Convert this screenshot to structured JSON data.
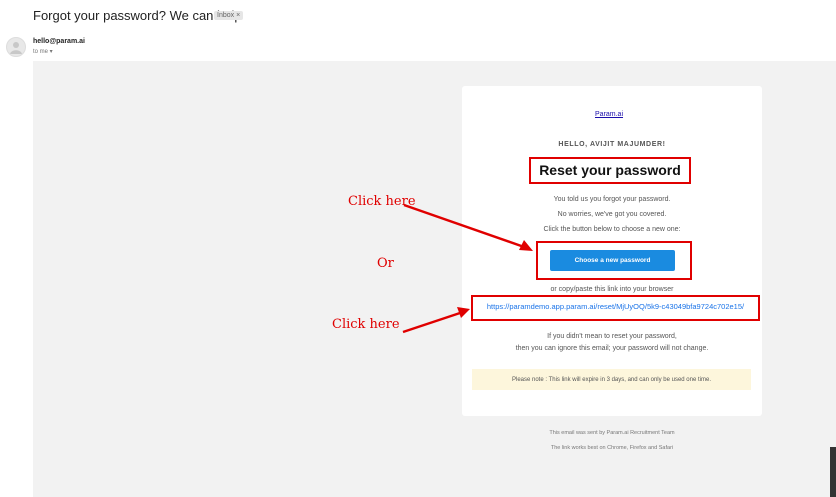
{
  "email": {
    "subject": "Forgot your password? We can help",
    "inbox_chip": "Inbox ×",
    "sender": "hello@param.ai",
    "to_line": "to me ▾"
  },
  "content": {
    "logo_alt": "Param.ai",
    "greeting": "HELLO, AVIJIT MAJUMDER!",
    "title": "Reset your password",
    "line1": "You told us you forgot your password.",
    "line2": "No worries, we've got you covered.",
    "line3": "Click the button below to choose a new one:",
    "button_label": "Choose a new password",
    "copy_hint": "or copy/paste this link into your browser",
    "reset_link": "https://paramdemo.app.param.ai/reset/MjUyOQ/5k9-c43049bfa9724c702e15/",
    "ignore1": "If you didn't mean to reset your password,",
    "ignore2": "then you can ignore this email; your password will not change.",
    "note": "Please note : This link will expire in 3 days, and can only be used one time.",
    "footer1": "This email was sent by Param.ai Recruitment Team",
    "footer2": "The link works best on Chrome, Firefox and Safari"
  },
  "annotations": {
    "click_here_1": "Click here",
    "or": "Or",
    "click_here_2": "Click here",
    "color": "#e00000"
  }
}
